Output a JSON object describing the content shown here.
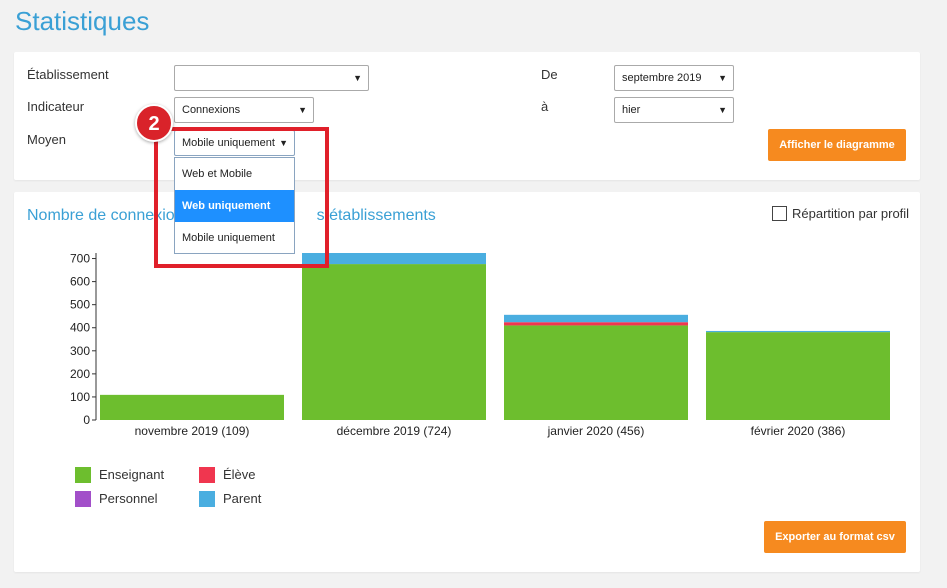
{
  "page": {
    "title": "Statistiques"
  },
  "filters": {
    "etablissement_label": "Établissement",
    "etablissement_value": "",
    "indicateur_label": "Indicateur",
    "indicateur_value": "Connexions",
    "moyen_label": "Moyen",
    "moyen_value": "Mobile uniquement",
    "de_label": "De",
    "de_value": "septembre 2019",
    "a_label": "à",
    "a_value": "hier",
    "afficher_button": "Afficher le diagramme"
  },
  "moyen_dropdown": {
    "options": [
      "Web et Mobile",
      "Web uniquement",
      "Mobile uniquement"
    ],
    "highlighted": "Web uniquement"
  },
  "annotation": {
    "step": "2"
  },
  "chart_section": {
    "title_left": "Nombre de connexio",
    "title_right": "s établissements",
    "repartition_label": "Répartition par profil",
    "repartition_checked": false,
    "export_button": "Exporter au format csv"
  },
  "colors": {
    "accent": "#3aa0d5",
    "button": "#f68a1f",
    "enseignant": "#6dbe2e",
    "eleve": "#f0364f",
    "personnel": "#a24fc9",
    "parent": "#4aaee0"
  },
  "chart_data": {
    "type": "bar",
    "stacked": true,
    "categories": [
      "novembre 2019 (109)",
      "décembre 2019 (724)",
      "janvier 2020 (456)",
      "février 2020 (386)"
    ],
    "series": [
      {
        "name": "Enseignant",
        "color": "#6dbe2e",
        "values": [
          109,
          676,
          410,
          381
        ]
      },
      {
        "name": "Élève",
        "color": "#f0364f",
        "values": [
          0,
          0,
          14,
          0
        ]
      },
      {
        "name": "Personnel",
        "color": "#a24fc9",
        "values": [
          0,
          0,
          0,
          0
        ]
      },
      {
        "name": "Parent",
        "color": "#4aaee0",
        "values": [
          0,
          48,
          32,
          5
        ]
      }
    ],
    "yticks": [
      0,
      100,
      200,
      300,
      400,
      500,
      600,
      700
    ],
    "ylim": [
      0,
      724
    ],
    "legend_position": "bottom-left",
    "grid": false
  }
}
